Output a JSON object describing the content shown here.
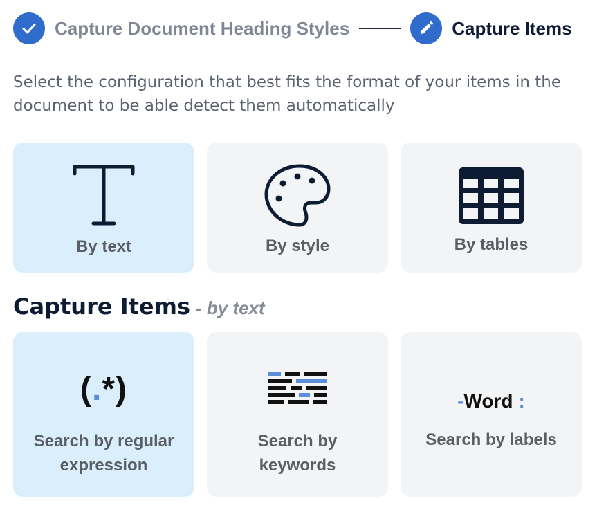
{
  "stepper": {
    "step1": {
      "label": "Capture Document Heading Styles",
      "status": "completed",
      "icon": "check-icon"
    },
    "step2": {
      "label": "Capture Items",
      "status": "active",
      "icon": "pencil-icon"
    }
  },
  "description": "Select the configuration that best fits the format of your items in the document to be able detect them automatically",
  "config_options": [
    {
      "label": "By text",
      "icon": "text-t-icon",
      "selected": true
    },
    {
      "label": "By style",
      "icon": "palette-icon",
      "selected": false
    },
    {
      "label": "By tables",
      "icon": "table-icon",
      "selected": false
    }
  ],
  "section": {
    "title": "Capture Items",
    "subtitle": "- by text"
  },
  "text_options": [
    {
      "label_line1": "Search by regular",
      "label_line2": "expression",
      "icon": "regex-icon",
      "icon_text": {
        "open": "(",
        "dot": ".",
        "close": "*)"
      },
      "selected": true
    },
    {
      "label_line1": "Search by",
      "label_line2": "keywords",
      "icon": "keywords-icon",
      "selected": false
    },
    {
      "label": "Search by labels",
      "icon": "word-label-icon",
      "icon_text": {
        "dash": "-",
        "word": "Word",
        "colon": ":"
      },
      "selected": false
    }
  ],
  "colors": {
    "accent": "#2f6ccb",
    "selected_card": "#dbeefc",
    "card": "#f3f4f6",
    "icon_dark": "#0d1b33",
    "icon_blue": "#5b8fd9"
  }
}
